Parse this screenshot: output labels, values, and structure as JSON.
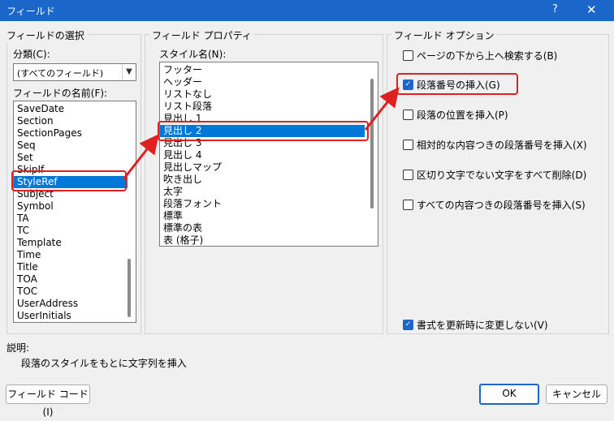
{
  "window": {
    "title": "フィールド",
    "help": "?",
    "close": "✕"
  },
  "selection": {
    "group_label": "フィールドの選択",
    "category_label": "分類(C):",
    "category_value": "(すべてのフィールド)",
    "names_label": "フィールドの名前(F):",
    "names": [
      "SaveDate",
      "Section",
      "SectionPages",
      "Seq",
      "Set",
      "SkipIf",
      "StyleRef",
      "Subject",
      "Symbol",
      "TA",
      "TC",
      "Template",
      "Time",
      "Title",
      "TOA",
      "TOC",
      "UserAddress",
      "UserInitials"
    ],
    "selected_name": "StyleRef"
  },
  "properties": {
    "group_label": "フィールド プロパティ",
    "styles_label": "スタイル名(N):",
    "styles": [
      "フッター",
      "ヘッダー",
      "リストなし",
      "リスト段落",
      "見出し 1",
      "見出し 2",
      "見出し 3",
      "見出し 4",
      "見出しマップ",
      "吹き出し",
      "太字",
      "段落フォント",
      "標準",
      "標準の表",
      "表 (格子)"
    ],
    "selected_style": "見出し 2"
  },
  "options": {
    "group_label": "フィールド オプション",
    "items": [
      {
        "label": "ページの下から上へ検索する(B)",
        "checked": false
      },
      {
        "label": "段落番号の挿入(G)",
        "checked": true
      },
      {
        "label": "段落の位置を挿入(P)",
        "checked": false
      },
      {
        "label": "相対的な内容つきの段落番号を挿入(X)",
        "checked": false
      },
      {
        "label": "区切り文字でない文字をすべて削除(D)",
        "checked": false
      },
      {
        "label": "すべての内容つきの段落番号を挿入(S)",
        "checked": false
      }
    ],
    "preserve_label": "書式を更新時に変更しない(V)",
    "preserve_checked": true
  },
  "description": {
    "label": "説明:",
    "text": "段落のスタイルをもとに文字列を挿入"
  },
  "buttons": {
    "field_codes": "フィールド コード(I)",
    "ok": "OK",
    "cancel": "キャンセル"
  },
  "colors": {
    "accent": "#1a66c9",
    "highlight": "#0078d7",
    "annotation": "#e02020"
  }
}
